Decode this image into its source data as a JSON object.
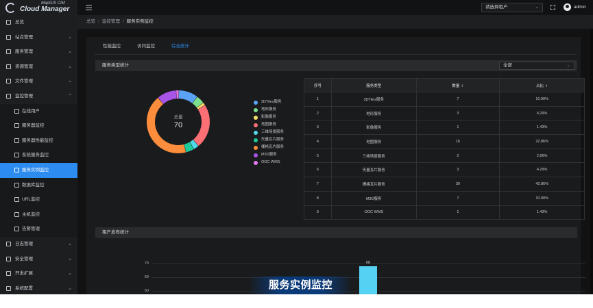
{
  "logo": {
    "top_text": "MapGIS CIM",
    "main_text": "Cloud Manager"
  },
  "sidebar": {
    "items": [
      {
        "label": "总览",
        "icon": "grid-icon",
        "has_children": false
      },
      {
        "label": "站点管理",
        "icon": "site-icon",
        "has_children": true
      },
      {
        "label": "服务管理",
        "icon": "service-icon",
        "has_children": true
      },
      {
        "label": "资源管理",
        "icon": "resource-icon",
        "has_children": true
      },
      {
        "label": "文件管理",
        "icon": "file-icon",
        "has_children": true
      },
      {
        "label": "监控管理",
        "icon": "monitor-icon",
        "has_children": true,
        "expanded": true
      }
    ],
    "submenu": [
      {
        "label": "在线用户",
        "icon": "users-icon"
      },
      {
        "label": "服务器监控",
        "icon": "server-icon"
      },
      {
        "label": "服务器性能监控",
        "icon": "server-performance-icon"
      },
      {
        "label": "系统服务监控",
        "icon": "system-service-icon"
      },
      {
        "label": "服务实例监控",
        "icon": "service-instance-icon",
        "active": true
      },
      {
        "label": "数据库监控",
        "icon": "database-icon"
      },
      {
        "label": "URL监控",
        "icon": "link-icon"
      },
      {
        "label": "主机监控",
        "icon": "host-icon"
      },
      {
        "label": "告警管理",
        "icon": "alert-icon"
      }
    ],
    "bottom_items": [
      {
        "label": "日志管理",
        "icon": "log-icon",
        "has_children": true
      },
      {
        "label": "安全管理",
        "icon": "security-icon",
        "has_children": true
      },
      {
        "label": "开发扩展",
        "icon": "extension-icon",
        "has_children": true
      },
      {
        "label": "系统配置",
        "icon": "settings-icon",
        "has_children": true
      }
    ]
  },
  "header": {
    "tenant_placeholder": "请选择租户",
    "user_name": "admin"
  },
  "breadcrumb": [
    "总览",
    "监控管理",
    "服务实例监控"
  ],
  "tabs": [
    {
      "label": "性能监控",
      "active": false
    },
    {
      "label": "访问监控",
      "active": false
    },
    {
      "label": "综合统计",
      "active": true
    }
  ],
  "service_type_section": {
    "title": "服务类型统计",
    "filter_value": "全部"
  },
  "donut": {
    "total_label": "总量",
    "total_value": "70",
    "colors": [
      "#5ba3f5",
      "#7de08c",
      "#f8e06a",
      "#fb6f75",
      "#4fd9e8",
      "#1ec99a",
      "#fb8d3d",
      "#a955e8",
      "#e47bf0"
    ]
  },
  "table": {
    "headers": [
      "序号",
      "服务类型",
      "数量",
      "占比"
    ],
    "rows": [
      [
        "1",
        "3DTiles服务",
        "7",
        "10.00%"
      ],
      [
        "2",
        "地形服务",
        "3",
        "4.29%"
      ],
      [
        "3",
        "影像服务",
        "1",
        "1.43%"
      ],
      [
        "4",
        "地图服务",
        "16",
        "22.86%"
      ],
      [
        "5",
        "三维场景服务",
        "2",
        "2.86%"
      ],
      [
        "6",
        "矢量瓦片服务",
        "3",
        "4.29%"
      ],
      [
        "7",
        "栅格瓦片服务",
        "30",
        "42.86%"
      ],
      [
        "8",
        "M3D服务",
        "7",
        "10.00%"
      ],
      [
        "9",
        "OGC WMS",
        "1",
        "1.43%"
      ]
    ]
  },
  "chart_data": [
    {
      "type": "pie",
      "categories": [
        "3DTiles服务",
        "地形服务",
        "影像服务",
        "地图服务",
        "三维场景服务",
        "矢量瓦片服务",
        "栅格瓦片服务",
        "M3D服务",
        "OGC WMS"
      ],
      "values": [
        7,
        3,
        1,
        16,
        2,
        3,
        30,
        7,
        1
      ],
      "legend_position": "right"
    },
    {
      "type": "bar",
      "categories": [
        ""
      ],
      "values": [
        68
      ],
      "yticks": [
        "70",
        "60",
        "50"
      ]
    }
  ],
  "tenant_section": {
    "title": "租户发布统计"
  },
  "caption": "服务实例监控"
}
